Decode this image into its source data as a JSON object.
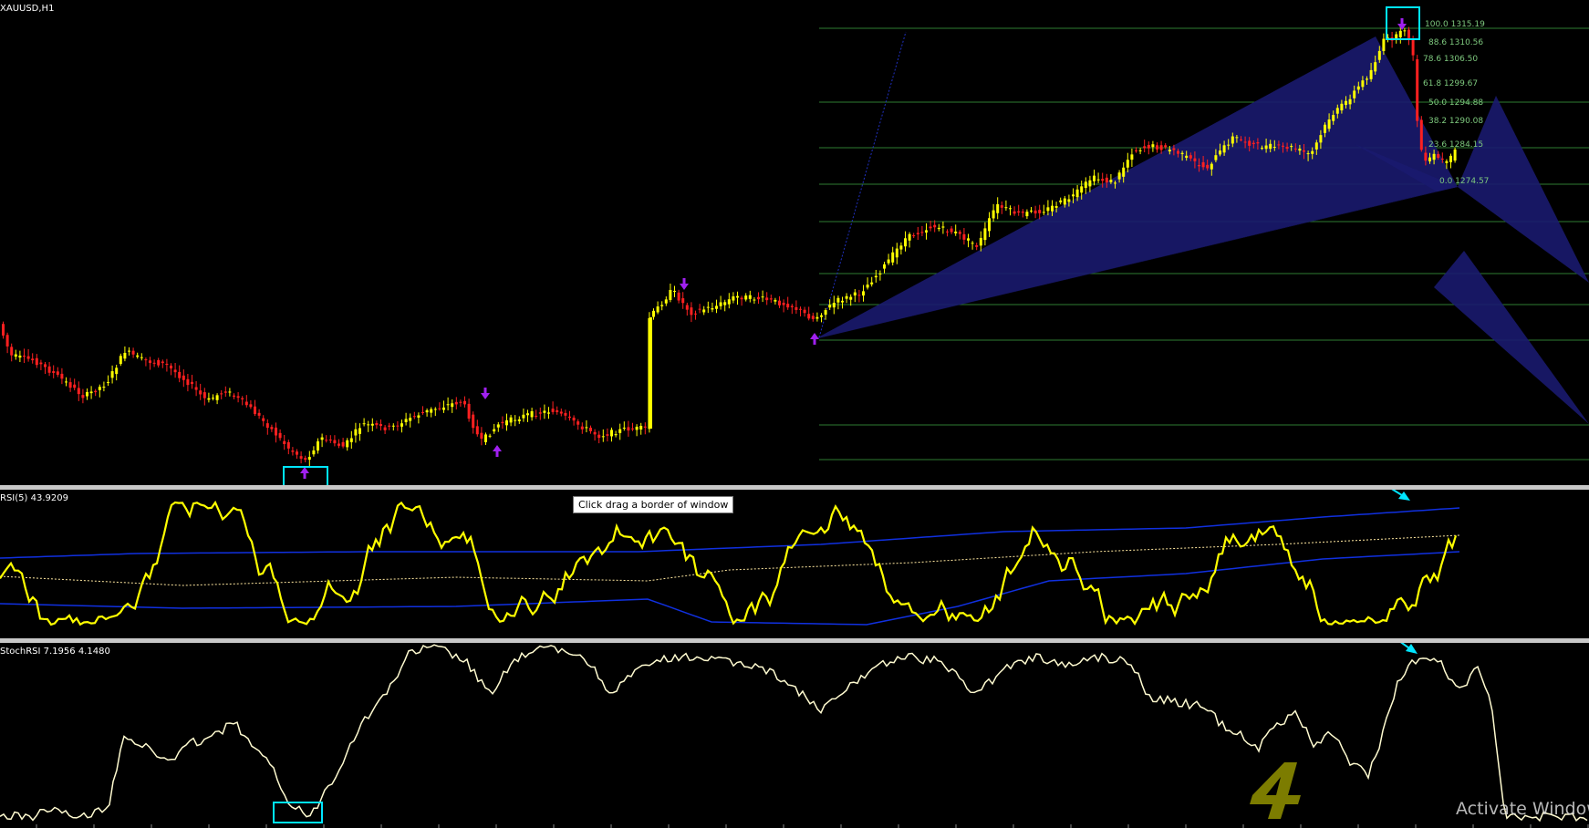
{
  "main_pane": {
    "label": "XAUUSD,H1",
    "fib_levels": [
      {
        "label": "100.0 1315.19"
      },
      {
        "label": "88.6 1310.56"
      },
      {
        "label": "78.6 1306.50"
      },
      {
        "label": "61.8 1299.67"
      },
      {
        "label": "50.0 1294.88"
      },
      {
        "label": "38.2 1290.08"
      },
      {
        "label": "23.6 1284.15"
      },
      {
        "label": "0.0 1274.57"
      }
    ]
  },
  "rsi_pane": {
    "label": "RSI(5) 43.9209"
  },
  "stoch_pane": {
    "label": "StochRSI 7.1956 4.1480"
  },
  "tooltip": {
    "text": "Click  drag a border of window"
  },
  "watermark": {
    "text": "Activate Windows"
  },
  "colors": {
    "background": "#000000",
    "candle_up": "#ffff00",
    "candle_down": "#ff2020",
    "pattern_fill": "#1a1a6e",
    "fib_line": "#2e7d32",
    "rsi_line": "#ffff00",
    "band_line": "#1030e0",
    "stoch_line": "#fffbd0",
    "highlight_box": "#00e5ff",
    "arrow_marker": "#a020f0"
  },
  "icons": [
    "buy-arrow-icon",
    "sell-arrow-icon",
    "highlight-box",
    "trend-arrow-icon",
    "logo-4-icon"
  ]
}
